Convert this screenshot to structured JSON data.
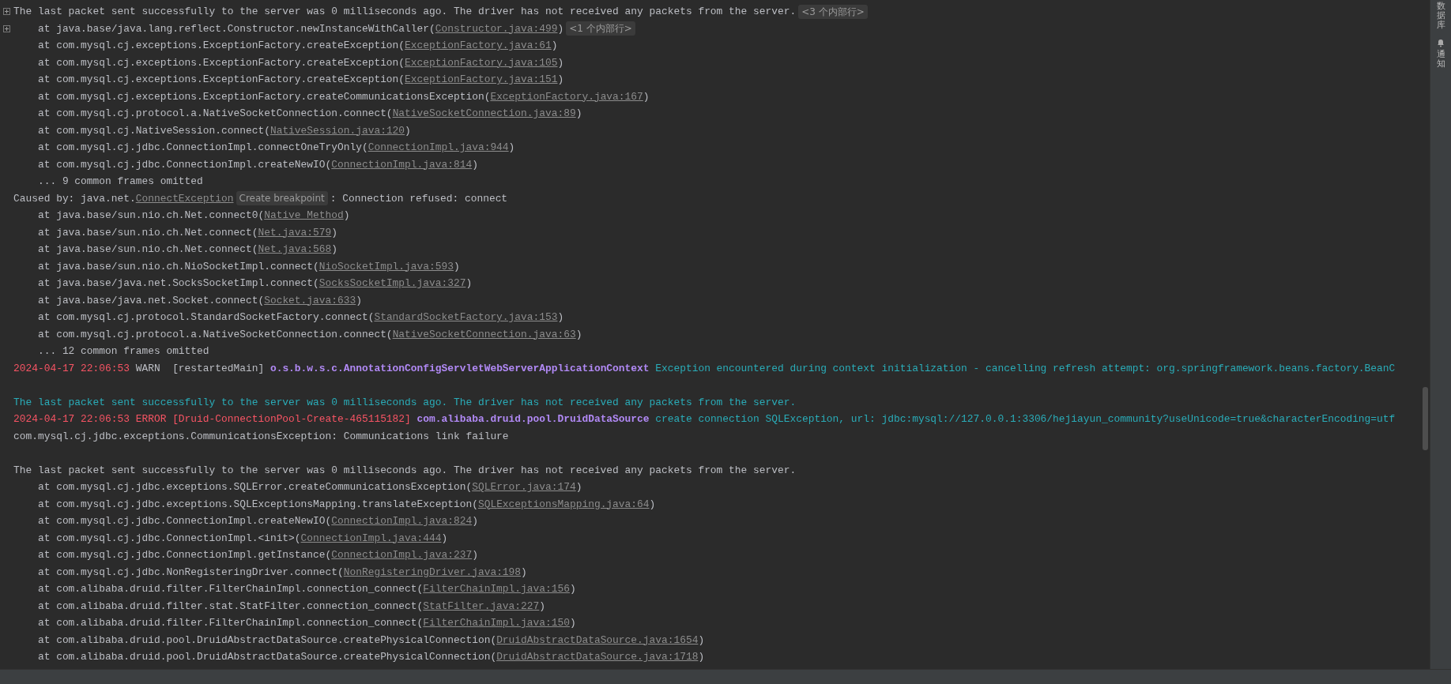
{
  "console": {
    "lines": [
      {
        "fold_icon": true,
        "segments": [
          {
            "kind": "plain",
            "text": "The last packet sent successfully to the server was 0 milliseconds ago. The driver has not received any packets from the server."
          },
          {
            "kind": "hint",
            "text": "<3 个内部行>"
          }
        ]
      },
      {
        "fold_icon": true,
        "segments": [
          {
            "kind": "plain",
            "text": "    at java.base/java.lang.reflect.Constructor.newInstanceWithCaller("
          },
          {
            "kind": "link",
            "text": "Constructor.java:499"
          },
          {
            "kind": "plain",
            "text": ")"
          },
          {
            "kind": "hint",
            "text": "<1 个内部行>"
          }
        ]
      },
      {
        "fold_icon": false,
        "segments": [
          {
            "kind": "plain",
            "text": "    at com.mysql.cj.exceptions.ExceptionFactory.createException("
          },
          {
            "kind": "link",
            "text": "ExceptionFactory.java:61"
          },
          {
            "kind": "plain",
            "text": ")"
          }
        ]
      },
      {
        "fold_icon": false,
        "segments": [
          {
            "kind": "plain",
            "text": "    at com.mysql.cj.exceptions.ExceptionFactory.createException("
          },
          {
            "kind": "link",
            "text": "ExceptionFactory.java:105"
          },
          {
            "kind": "plain",
            "text": ")"
          }
        ]
      },
      {
        "fold_icon": false,
        "segments": [
          {
            "kind": "plain",
            "text": "    at com.mysql.cj.exceptions.ExceptionFactory.createException("
          },
          {
            "kind": "link",
            "text": "ExceptionFactory.java:151"
          },
          {
            "kind": "plain",
            "text": ")"
          }
        ]
      },
      {
        "fold_icon": false,
        "segments": [
          {
            "kind": "plain",
            "text": "    at com.mysql.cj.exceptions.ExceptionFactory.createCommunicationsException("
          },
          {
            "kind": "link",
            "text": "ExceptionFactory.java:167"
          },
          {
            "kind": "plain",
            "text": ")"
          }
        ]
      },
      {
        "fold_icon": false,
        "segments": [
          {
            "kind": "plain",
            "text": "    at com.mysql.cj.protocol.a.NativeSocketConnection.connect("
          },
          {
            "kind": "link",
            "text": "NativeSocketConnection.java:89"
          },
          {
            "kind": "plain",
            "text": ")"
          }
        ]
      },
      {
        "fold_icon": false,
        "segments": [
          {
            "kind": "plain",
            "text": "    at com.mysql.cj.NativeSession.connect("
          },
          {
            "kind": "link",
            "text": "NativeSession.java:120"
          },
          {
            "kind": "plain",
            "text": ")"
          }
        ]
      },
      {
        "fold_icon": false,
        "segments": [
          {
            "kind": "plain",
            "text": "    at com.mysql.cj.jdbc.ConnectionImpl.connectOneTryOnly("
          },
          {
            "kind": "link",
            "text": "ConnectionImpl.java:944"
          },
          {
            "kind": "plain",
            "text": ")"
          }
        ]
      },
      {
        "fold_icon": false,
        "segments": [
          {
            "kind": "plain",
            "text": "    at com.mysql.cj.jdbc.ConnectionImpl.createNewIO("
          },
          {
            "kind": "link",
            "text": "ConnectionImpl.java:814"
          },
          {
            "kind": "plain",
            "text": ")"
          }
        ]
      },
      {
        "fold_icon": false,
        "segments": [
          {
            "kind": "plain",
            "text": "    ... 9 common frames omitted"
          }
        ]
      },
      {
        "fold_icon": false,
        "segments": [
          {
            "kind": "plain",
            "text": "Caused by: java.net."
          },
          {
            "kind": "link",
            "text": "ConnectException"
          },
          {
            "kind": "hint",
            "text": "Create breakpoint"
          },
          {
            "kind": "plain",
            "text": ": Connection refused: connect"
          }
        ]
      },
      {
        "fold_icon": false,
        "segments": [
          {
            "kind": "plain",
            "text": "    at java.base/sun.nio.ch.Net.connect0("
          },
          {
            "kind": "link",
            "text": "Native Method"
          },
          {
            "kind": "plain",
            "text": ")"
          }
        ]
      },
      {
        "fold_icon": false,
        "segments": [
          {
            "kind": "plain",
            "text": "    at java.base/sun.nio.ch.Net.connect("
          },
          {
            "kind": "link",
            "text": "Net.java:579"
          },
          {
            "kind": "plain",
            "text": ")"
          }
        ]
      },
      {
        "fold_icon": false,
        "segments": [
          {
            "kind": "plain",
            "text": "    at java.base/sun.nio.ch.Net.connect("
          },
          {
            "kind": "link",
            "text": "Net.java:568"
          },
          {
            "kind": "plain",
            "text": ")"
          }
        ]
      },
      {
        "fold_icon": false,
        "segments": [
          {
            "kind": "plain",
            "text": "    at java.base/sun.nio.ch.NioSocketImpl.connect("
          },
          {
            "kind": "link",
            "text": "NioSocketImpl.java:593"
          },
          {
            "kind": "plain",
            "text": ")"
          }
        ]
      },
      {
        "fold_icon": false,
        "segments": [
          {
            "kind": "plain",
            "text": "    at java.base/java.net.SocksSocketImpl.connect("
          },
          {
            "kind": "link",
            "text": "SocksSocketImpl.java:327"
          },
          {
            "kind": "plain",
            "text": ")"
          }
        ]
      },
      {
        "fold_icon": false,
        "segments": [
          {
            "kind": "plain",
            "text": "    at java.base/java.net.Socket.connect("
          },
          {
            "kind": "link",
            "text": "Socket.java:633"
          },
          {
            "kind": "plain",
            "text": ")"
          }
        ]
      },
      {
        "fold_icon": false,
        "segments": [
          {
            "kind": "plain",
            "text": "    at com.mysql.cj.protocol.StandardSocketFactory.connect("
          },
          {
            "kind": "link",
            "text": "StandardSocketFactory.java:153"
          },
          {
            "kind": "plain",
            "text": ")"
          }
        ]
      },
      {
        "fold_icon": false,
        "segments": [
          {
            "kind": "plain",
            "text": "    at com.mysql.cj.protocol.a.NativeSocketConnection.connect("
          },
          {
            "kind": "link",
            "text": "NativeSocketConnection.java:63"
          },
          {
            "kind": "plain",
            "text": ")"
          }
        ]
      },
      {
        "fold_icon": false,
        "segments": [
          {
            "kind": "plain",
            "text": "    ... 12 common frames omitted"
          }
        ]
      },
      {
        "fold_icon": false,
        "segments": [
          {
            "kind": "error",
            "text": "2024-04-17 22:06:53"
          },
          {
            "kind": "plain",
            "text": " WARN  [restartedMain] "
          },
          {
            "kind": "logger",
            "text": "o.s.b.w.s.c.AnnotationConfigServletWebServerApplicationContext"
          },
          {
            "kind": "message",
            "text": " Exception encountered during context initialization - cancelling refresh attempt: org.springframework.beans.factory.BeanC"
          }
        ]
      },
      {
        "fold_icon": false
      },
      {
        "fold_icon": false,
        "segments": [
          {
            "kind": "message",
            "text": "The last packet sent successfully to the server was 0 milliseconds ago. The driver has not received any packets from the server."
          }
        ]
      },
      {
        "fold_icon": false,
        "segments": [
          {
            "kind": "error",
            "text": "2024-04-17 22:06:53 ERROR [Druid-ConnectionPool-Create-465115182]"
          },
          {
            "kind": "logger",
            "text": " com.alibaba.druid.pool.DruidDataSource"
          },
          {
            "kind": "message",
            "text": " create connection SQLException, url: jdbc:mysql://127.0.0.1:3306/hejiayun_community?useUnicode=true&characterEncoding=utf"
          }
        ]
      },
      {
        "fold_icon": false,
        "segments": [
          {
            "kind": "plain",
            "text": "com.mysql.cj.jdbc.exceptions.CommunicationsException: Communications link failure"
          }
        ]
      },
      {
        "fold_icon": false
      },
      {
        "fold_icon": false,
        "segments": [
          {
            "kind": "plain",
            "text": "The last packet sent successfully to the server was 0 milliseconds ago. The driver has not received any packets from the server."
          }
        ]
      },
      {
        "fold_icon": false,
        "segments": [
          {
            "kind": "plain",
            "text": "    at com.mysql.cj.jdbc.exceptions.SQLError.createCommunicationsException("
          },
          {
            "kind": "link",
            "text": "SQLError.java:174"
          },
          {
            "kind": "plain",
            "text": ")"
          }
        ]
      },
      {
        "fold_icon": false,
        "segments": [
          {
            "kind": "plain",
            "text": "    at com.mysql.cj.jdbc.exceptions.SQLExceptionsMapping.translateException("
          },
          {
            "kind": "link",
            "text": "SQLExceptionsMapping.java:64"
          },
          {
            "kind": "plain",
            "text": ")"
          }
        ]
      },
      {
        "fold_icon": false,
        "segments": [
          {
            "kind": "plain",
            "text": "    at com.mysql.cj.jdbc.ConnectionImpl.createNewIO("
          },
          {
            "kind": "link",
            "text": "ConnectionImpl.java:824"
          },
          {
            "kind": "plain",
            "text": ")"
          }
        ]
      },
      {
        "fold_icon": false,
        "segments": [
          {
            "kind": "plain",
            "text": "    at com.mysql.cj.jdbc.ConnectionImpl.<init>("
          },
          {
            "kind": "link",
            "text": "ConnectionImpl.java:444"
          },
          {
            "kind": "plain",
            "text": ")"
          }
        ]
      },
      {
        "fold_icon": false,
        "segments": [
          {
            "kind": "plain",
            "text": "    at com.mysql.cj.jdbc.ConnectionImpl.getInstance("
          },
          {
            "kind": "link",
            "text": "ConnectionImpl.java:237"
          },
          {
            "kind": "plain",
            "text": ")"
          }
        ]
      },
      {
        "fold_icon": false,
        "segments": [
          {
            "kind": "plain",
            "text": "    at com.mysql.cj.jdbc.NonRegisteringDriver.connect("
          },
          {
            "kind": "link",
            "text": "NonRegisteringDriver.java:198"
          },
          {
            "kind": "plain",
            "text": ")"
          }
        ]
      },
      {
        "fold_icon": false,
        "segments": [
          {
            "kind": "plain",
            "text": "    at com.alibaba.druid.filter.FilterChainImpl.connection_connect("
          },
          {
            "kind": "link",
            "text": "FilterChainImpl.java:156"
          },
          {
            "kind": "plain",
            "text": ")"
          }
        ]
      },
      {
        "fold_icon": false,
        "segments": [
          {
            "kind": "plain",
            "text": "    at com.alibaba.druid.filter.stat.StatFilter.connection_connect("
          },
          {
            "kind": "link",
            "text": "StatFilter.java:227"
          },
          {
            "kind": "plain",
            "text": ")"
          }
        ]
      },
      {
        "fold_icon": false,
        "segments": [
          {
            "kind": "plain",
            "text": "    at com.alibaba.druid.filter.FilterChainImpl.connection_connect("
          },
          {
            "kind": "link",
            "text": "FilterChainImpl.java:150"
          },
          {
            "kind": "plain",
            "text": ")"
          }
        ]
      },
      {
        "fold_icon": false,
        "segments": [
          {
            "kind": "plain",
            "text": "    at com.alibaba.druid.pool.DruidAbstractDataSource.createPhysicalConnection("
          },
          {
            "kind": "link",
            "text": "DruidAbstractDataSource.java:1654"
          },
          {
            "kind": "plain",
            "text": ")"
          }
        ]
      },
      {
        "fold_icon": false,
        "segments": [
          {
            "kind": "plain",
            "text": "    at com.alibaba.druid.pool.DruidAbstractDataSource.createPhysicalConnection("
          },
          {
            "kind": "link",
            "text": "DruidAbstractDataSource.java:1718"
          },
          {
            "kind": "plain",
            "text": ")"
          }
        ]
      }
    ]
  },
  "right_sidebar": {
    "tabs": [
      {
        "label": "数据库"
      },
      {
        "label": "通知"
      }
    ]
  }
}
